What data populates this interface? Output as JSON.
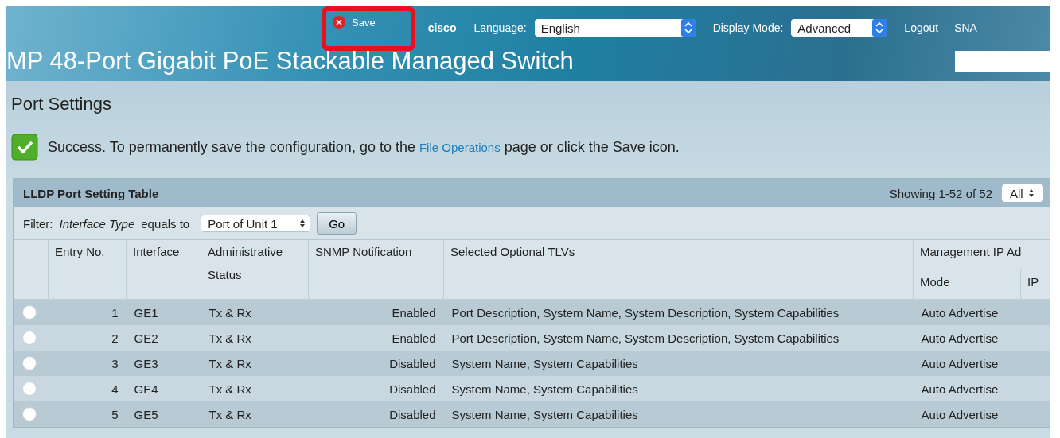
{
  "header": {
    "save": {
      "label": "Save",
      "highlighted": true
    },
    "brand": "cisco",
    "language": {
      "label": "Language:",
      "value": "English"
    },
    "display_mode": {
      "label": "Display Mode:",
      "value": "Advanced"
    },
    "logout": "Logout",
    "cut_link": "SNA",
    "title": "MP 48-Port Gigabit PoE Stackable Managed Switch"
  },
  "page_title": "Port Settings",
  "message": {
    "text": "Success. To permanently save the configuration, go to the ",
    "link": "File Operations",
    "text_after": " page or click the Save icon."
  },
  "table": {
    "title": "LLDP Port Setting Table",
    "showing": "Showing 1-52 of 52",
    "per_page": "All",
    "filter": {
      "label": "Filter:",
      "field": "Interface Type",
      "op": "equals to",
      "value": "Port of Unit 1",
      "button": "Go"
    },
    "columns": [
      "Entry No.",
      "Interface",
      "Administrative Status",
      "SNMP Notification",
      "Selected Optional TLVs"
    ],
    "group_column": {
      "label": "Management IP Ad",
      "sub": [
        "Mode",
        "IP"
      ]
    },
    "rows": [
      {
        "selected": false,
        "entry": "1",
        "interface": "GE1",
        "status": "Tx & Rx",
        "snmp": "Enabled",
        "tlvs": "Port Description, System Name, System Description, System Capabilities",
        "mode": "Auto Advertise"
      },
      {
        "selected": false,
        "entry": "2",
        "interface": "GE2",
        "status": "Tx & Rx",
        "snmp": "Enabled",
        "tlvs": "Port Description, System Name, System Description, System Capabilities",
        "mode": "Auto Advertise"
      },
      {
        "selected": false,
        "entry": "3",
        "interface": "GE3",
        "status": "Tx & Rx",
        "snmp": "Disabled",
        "tlvs": "System Name, System Capabilities",
        "mode": "Auto Advertise"
      },
      {
        "selected": false,
        "entry": "4",
        "interface": "GE4",
        "status": "Tx & Rx",
        "snmp": "Disabled",
        "tlvs": "System Name, System Capabilities",
        "mode": "Auto Advertise"
      },
      {
        "selected": false,
        "entry": "5",
        "interface": "GE5",
        "status": "Tx & Rx",
        "snmp": "Disabled",
        "tlvs": "System Name, System Capabilities",
        "mode": "Auto Advertise"
      }
    ]
  }
}
